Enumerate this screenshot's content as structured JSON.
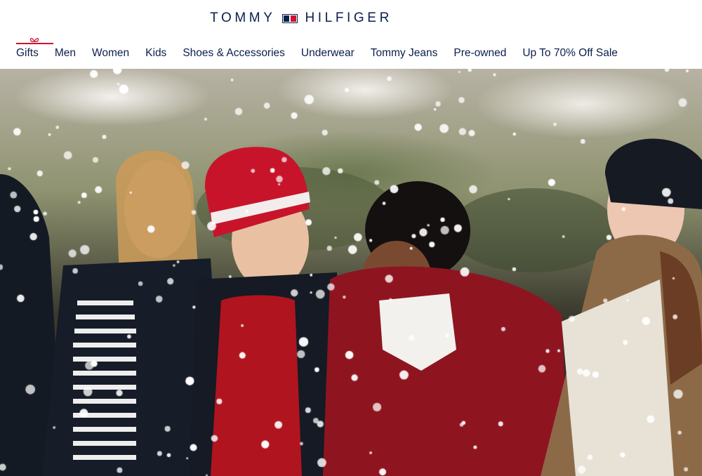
{
  "brand": {
    "name_left": "TOMMY",
    "name_right": "HILFIGER",
    "colors": {
      "navy": "#0b1f4b",
      "red": "#cc1230"
    }
  },
  "nav": {
    "items": [
      {
        "label": "Gifts",
        "icon": "gift-bow-icon"
      },
      {
        "label": "Men"
      },
      {
        "label": "Women"
      },
      {
        "label": "Kids"
      },
      {
        "label": "Shoes & Accessories"
      },
      {
        "label": "Underwear"
      },
      {
        "label": "Tommy Jeans"
      },
      {
        "label": "Pre-owned"
      },
      {
        "label": "Up To 70% Off Sale"
      }
    ]
  },
  "hero": {
    "image": "four-people-laughing-in-snow-photo"
  }
}
